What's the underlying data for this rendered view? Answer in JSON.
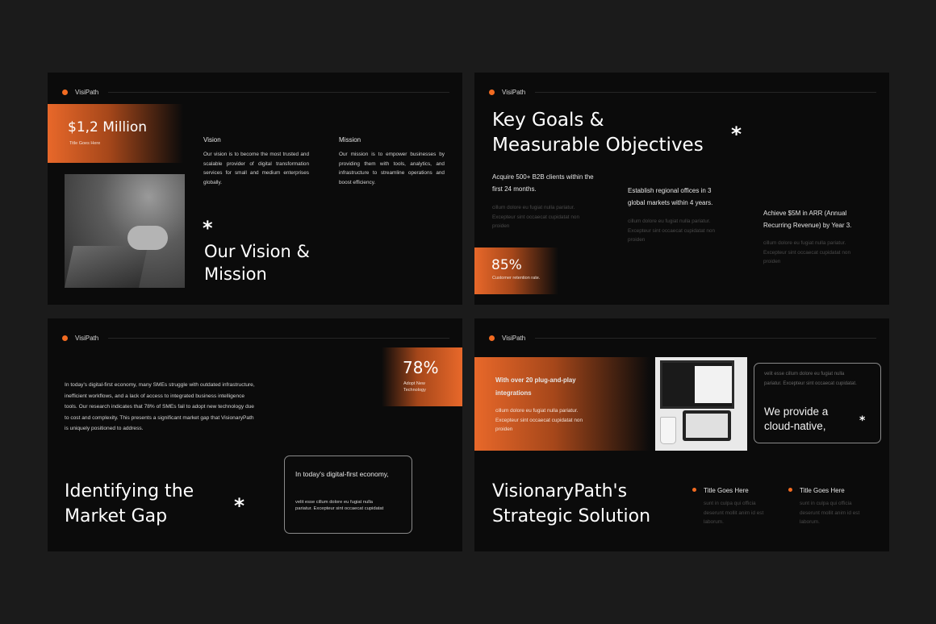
{
  "brand": "VisiPath",
  "colors": {
    "accent": "#f26b21",
    "background": "#1b1b1b",
    "slide_bg": "#0b0b0b"
  },
  "slide1": {
    "stat_value": "$1,2 Million",
    "stat_caption": "Title Goes Here",
    "vision_title": "Vision",
    "vision_text": "Our vision is to become the most trusted and scalable provider of digital transformation services for small and medium enterprises globally.",
    "mission_title": "Mission",
    "mission_text": "Our mission is to empower businesses by providing them with tools, analytics, and infrastructure to streamline operations and boost efficiency.",
    "heading_line1": "Our Vision &",
    "heading_line2": "Mission",
    "asterisk": "*"
  },
  "slide2": {
    "heading_line1": "Key Goals &",
    "heading_line2": "Measurable Objectives",
    "asterisk": "*",
    "goal1": "Acquire 500+ B2B clients within the first 24 months.",
    "goal1_filler": "cillum dolore eu fugiat nulla pariatur. Excepteur sint occaecat cupidatat non proiden",
    "goal2": "Establish regional offices in 3 global markets within 4 years.",
    "goal2_filler": "cillum dolore eu fugiat nulla pariatur. Excepteur sint occaecat cupidatat non proiden",
    "goal3": "Achieve $5M in ARR (Annual Recurring Revenue) by Year 3.",
    "goal3_filler": "cillum dolore eu fugiat nulla pariatur. Excepteur sint occaecat cupidatat non proiden",
    "stat_value": "85%",
    "stat_caption": "Customer retention rate."
  },
  "slide3": {
    "stat_value": "78%",
    "stat_caption": "Adopt New Technology",
    "body": "In today's digital-first economy, many SMEs struggle with outdated infrastructure, inefficient workflows, and a lack of access to integrated business intelligence tools. Our research indicates that 78% of SMEs fail to adopt new technology due to cost and complexity. This presents a significant market gap that VisionaryPath is uniquely positioned to address.",
    "heading_line1": "Identifying the",
    "heading_line2": "Market Gap",
    "asterisk": "*",
    "card_title": "In today's digital-first economy,",
    "card_text": "velit esse cillum dolore eu fugiat nulla pariatur. Excepteur sint occaecat cupidatat"
  },
  "slide4": {
    "promo_title": "With over 20 plug-and-play integrations",
    "promo_text": "cillum dolore eu fugiat nulla pariatur. Excepteur sint occaecat cupidatat non proiden",
    "card_filler": "velit esse cillum dolore eu fugiat nulla pariatur. Excepteur sint occaecat cupidatat.",
    "card_title": "We provide a cloud-native,",
    "card_asterisk": "*",
    "heading_line1": "VisionaryPath's",
    "heading_line2": "Strategic Solution",
    "item1_title": "Title Goes Here",
    "item1_text": "sunt in culpa qui officia deserunt mollit anim id est laborum.",
    "item2_title": "Title Goes Here",
    "item2_text": "sunt in culpa qui officia deserunt mollit anim id est laborum."
  }
}
